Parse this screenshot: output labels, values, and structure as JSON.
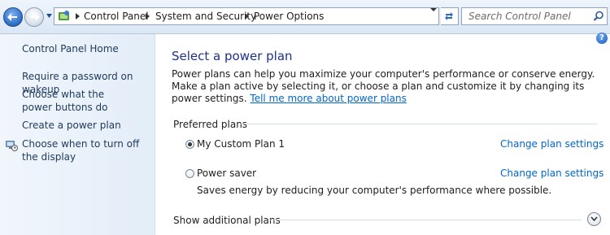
{
  "address_bar": {
    "breadcrumbs": [
      "Control Panel",
      "System and Security",
      "Power Options"
    ]
  },
  "search": {
    "placeholder": "Search Control Panel"
  },
  "left_nav": {
    "home": "Control Panel Home",
    "items": [
      "Require a password on wakeup",
      "Choose what the power buttons do",
      "Create a power plan",
      "Choose when to turn off the display"
    ]
  },
  "main": {
    "title": "Select a power plan",
    "intro": "Power plans can help you maximize your computer's performance or conserve energy. Make a plan active by selecting it, or choose a plan and customize it by changing its power settings.",
    "intro_link": "Tell me more about power plans",
    "preferred_label": "Preferred plans",
    "plans": [
      {
        "name": "My Custom Plan 1",
        "selected": true,
        "change_label": "Change plan settings",
        "description": ""
      },
      {
        "name": "Power saver",
        "selected": false,
        "change_label": "Change plan settings",
        "description": "Saves energy by reducing your computer's performance where possible."
      }
    ],
    "show_additional": "Show additional plans"
  },
  "icons": {
    "back": "back-arrow-icon",
    "forward": "forward-arrow-icon",
    "control_panel": "control-panel-icon",
    "refresh": "refresh-icon",
    "search": "search-icon",
    "help": "help-icon",
    "display": "monitor-clock-icon",
    "expand": "chevron-down-icon"
  },
  "colors": {
    "link": "#0066cc",
    "title": "#1e3287",
    "nav_text": "#1e395b"
  }
}
